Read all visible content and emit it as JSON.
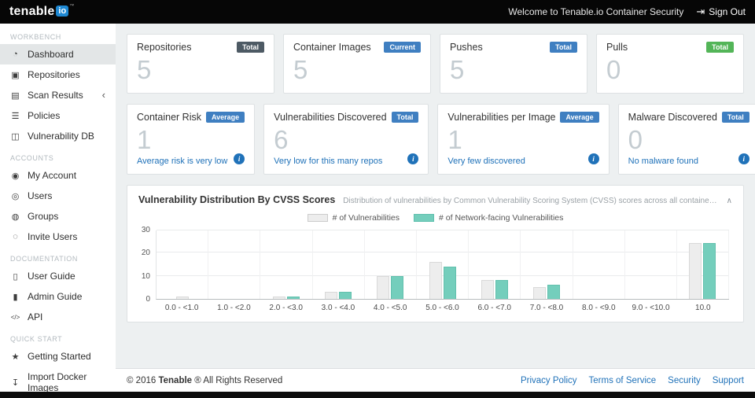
{
  "topbar": {
    "logo": {
      "brand": "tenable",
      "badge": "io",
      "tm": "™"
    },
    "welcome": "Welcome to Tenable.io Container Security",
    "sign_out": "Sign Out"
  },
  "icons": {
    "dashboard": "◔",
    "repositories": "▣",
    "scan_results": "▤",
    "policies": "☰",
    "vulnerability_db": "◫",
    "my_account": "◉",
    "users": "◎",
    "groups": "◍",
    "invite_users": "◌",
    "user_guide": "▯",
    "admin_guide": "▮",
    "api": "</>",
    "getting_started": "★",
    "import_docker_images": "↧",
    "sign_out": "⇥",
    "chevron_collapsed": "‹",
    "collapse": "∧",
    "info": "i"
  },
  "sidebar": {
    "sections": [
      {
        "header": "WORKBENCH",
        "items": [
          {
            "label": "Dashboard"
          },
          {
            "label": "Repositories"
          },
          {
            "label": "Scan Results"
          },
          {
            "label": "Policies"
          },
          {
            "label": "Vulnerability DB"
          }
        ]
      },
      {
        "header": "ACCOUNTS",
        "items": [
          {
            "label": "My Account"
          },
          {
            "label": "Users"
          },
          {
            "label": "Groups"
          },
          {
            "label": "Invite Users"
          }
        ]
      },
      {
        "header": "DOCUMENTATION",
        "items": [
          {
            "label": "User Guide"
          },
          {
            "label": "Admin Guide"
          },
          {
            "label": "API"
          }
        ]
      },
      {
        "header": "QUICK START",
        "items": [
          {
            "label": "Getting Started"
          },
          {
            "label": "Import Docker Images"
          }
        ]
      }
    ]
  },
  "cards": {
    "row1": [
      {
        "title": "Repositories",
        "badge": "Total",
        "value": "5"
      },
      {
        "title": "Container Images",
        "badge": "Current",
        "value": "5"
      },
      {
        "title": "Pushes",
        "badge": "Total",
        "value": "5"
      },
      {
        "title": "Pulls",
        "badge": "Total",
        "value": "0"
      }
    ],
    "row2": [
      {
        "title": "Container Risk",
        "badge": "Average",
        "value": "1",
        "subtitle": "Average risk is very low"
      },
      {
        "title": "Vulnerabilities Discovered",
        "badge": "Total",
        "value": "6",
        "subtitle": "Very low for this many repos"
      },
      {
        "title": "Vulnerabilities per Image",
        "badge": "Average",
        "value": "1",
        "subtitle": "Very few discovered"
      },
      {
        "title": "Malware Discovered",
        "badge": "Total",
        "value": "0",
        "subtitle": "No malware found"
      }
    ]
  },
  "chart": {
    "title": "Vulnerability Distribution By CVSS Scores",
    "description": "Distribution of vulnerabilities by Common Vulnerability Scoring System (CVSS) scores across all container images in all repositories"
  },
  "chart_data": {
    "type": "bar",
    "title": "Vulnerability Distribution By CVSS Scores",
    "categories": [
      "0.0 - <1.0",
      "1.0 - <2.0",
      "2.0 - <3.0",
      "3.0 - <4.0",
      "4.0 - <5.0",
      "5.0 - <6.0",
      "6.0 - <7.0",
      "7.0 - <8.0",
      "8.0 - <9.0",
      "9.0 - <10.0",
      "10.0"
    ],
    "series": [
      {
        "name": "# of Vulnerabilities",
        "color": "#ededed",
        "values": [
          1,
          0,
          1,
          3,
          10,
          16,
          8,
          5,
          0,
          0,
          24
        ]
      },
      {
        "name": "# of Network-facing Vulnerabilities",
        "color": "#74cebc",
        "values": [
          0,
          0,
          1,
          3,
          10,
          14,
          8,
          6,
          0,
          0,
          24
        ]
      }
    ],
    "ylim": [
      0,
      30
    ],
    "yticks": [
      0,
      10,
      20,
      30
    ],
    "legend_position": "top",
    "grid": true
  },
  "footer": {
    "copyright_prefix": "© 2016",
    "brand": "Tenable",
    "copyright_suffix": "® All Rights Reserved",
    "links": [
      "Privacy Policy",
      "Terms of Service",
      "Security",
      "Support"
    ]
  },
  "theme": {
    "topbar_bg": "#060606",
    "logo_badge": "#1e88d2",
    "badge_dark": "#4d5a64",
    "badge_blue": "#3f7fc1",
    "badge_green": "#53b558",
    "link_blue": "#2072b9",
    "metric_gray": "#c4ccd1",
    "bar_gray": "#ededed",
    "bar_teal": "#74cebc",
    "main_bg": "#edf0f1"
  }
}
